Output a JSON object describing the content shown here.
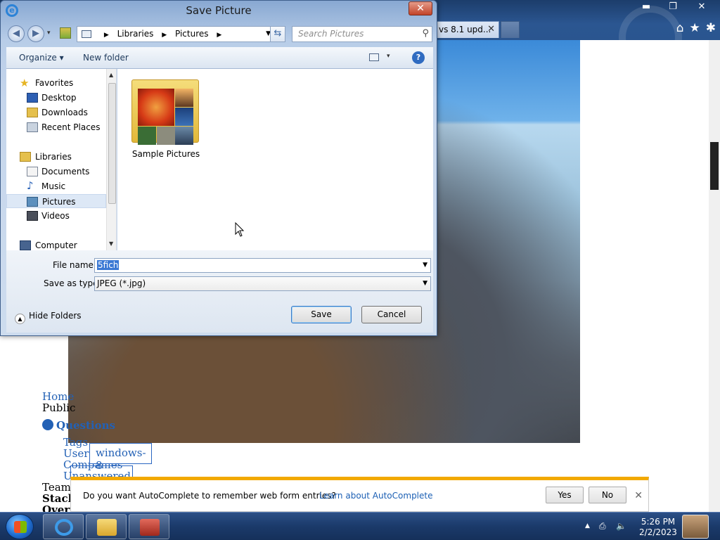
{
  "browser": {
    "tab_title": "vs 8.1 upd...",
    "tab_close": "✕",
    "window_controls": {
      "minimize": "▬",
      "restore": "❐",
      "close": "✕"
    },
    "toolbar_icons": {
      "home": "⌂",
      "favorites": "★",
      "tools": "✱"
    }
  },
  "page": {
    "nav": {
      "home": "Home",
      "public": "Public",
      "questions": "Questions",
      "tags": "Tags",
      "users": "Users",
      "companies": "Companies",
      "unanswered": "Unanswered",
      "teams": "Teams",
      "stack": "Stack",
      "overflow": "Overf"
    },
    "tag": "windows-8"
  },
  "autocomplete": {
    "message": "Do you want AutoComplete to remember web form entries?",
    "link": "Learn about AutoComplete",
    "yes": "Yes",
    "no": "No",
    "close": "✕"
  },
  "dialog": {
    "title": "Save Picture",
    "close": "✕",
    "nav": {
      "back": "◀",
      "forward": "▶",
      "history_drop": "▾",
      "refresh": "⇆"
    },
    "address": {
      "crumbs": [
        "Libraries",
        "Pictures"
      ],
      "sep": "▶"
    },
    "search": {
      "placeholder": "Search Pictures",
      "icon": "⚲"
    },
    "command_bar": {
      "organize": "Organize ▾",
      "new_folder": "New folder",
      "view_drop": "▾",
      "help": "?"
    },
    "nav_pane": {
      "favorites": "Favorites",
      "desktop": "Desktop",
      "downloads": "Downloads",
      "recent": "Recent Places",
      "libraries": "Libraries",
      "documents": "Documents",
      "music": "Music",
      "pictures": "Pictures",
      "videos": "Videos",
      "computer": "Computer",
      "scroll_up": "▲",
      "scroll_down": "▼"
    },
    "folder": {
      "label": "Sample Pictures"
    },
    "file_name": {
      "label": "File name:",
      "value": "5fich",
      "drop": "▼"
    },
    "save_type": {
      "label": "Save as type:",
      "value": "JPEG (*.jpg)",
      "drop": "▼"
    },
    "hide_folders": "Hide Folders",
    "hide_icon": "▲",
    "save": "Save",
    "cancel": "Cancel"
  },
  "taskbar": {
    "time": "5:26 PM",
    "date": "2/2/2023",
    "tray": {
      "up": "▲",
      "network": "⎙",
      "volume": "🔈"
    }
  }
}
